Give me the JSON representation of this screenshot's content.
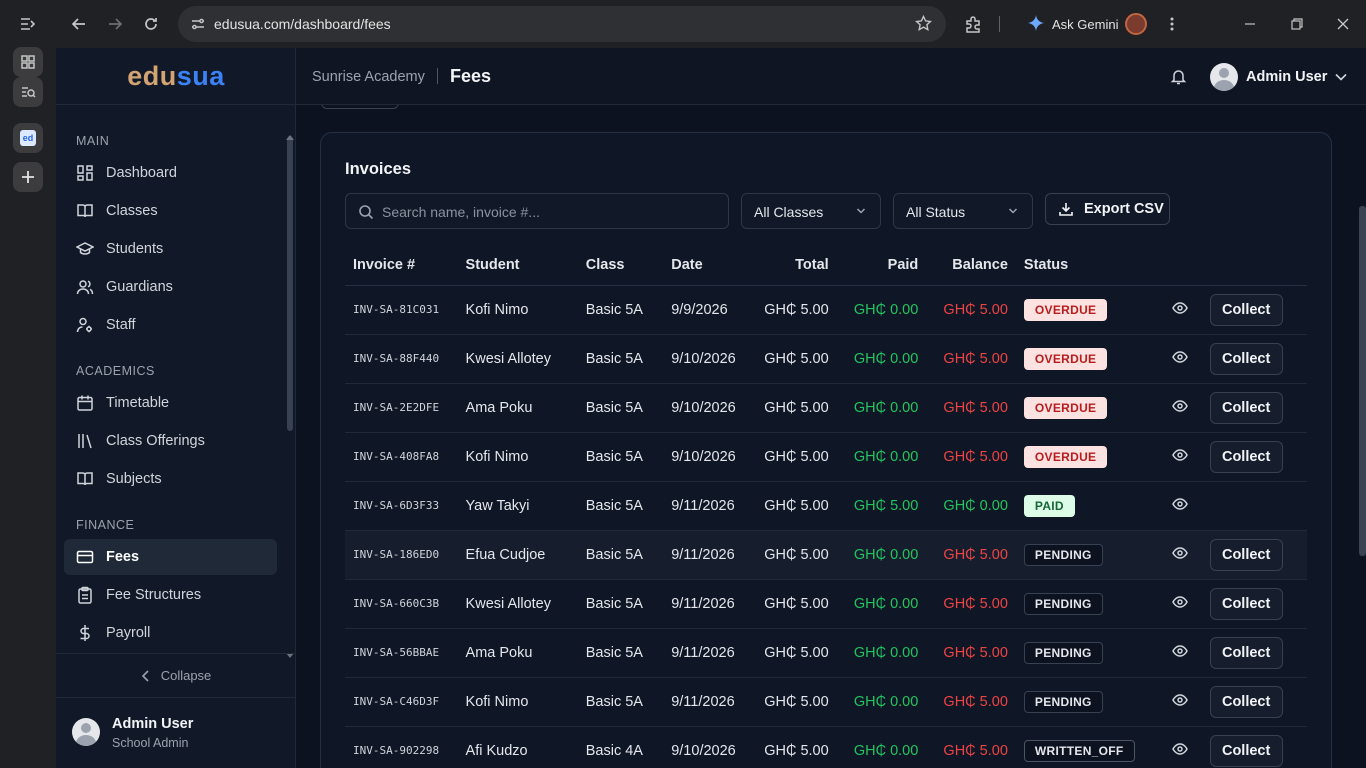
{
  "browser": {
    "url": "edusua.com/dashboard/fees",
    "gemini_label": "Ask Gemini"
  },
  "app": {
    "logo_part1": "edu",
    "logo_part2": "sua"
  },
  "sidebar": {
    "sections": [
      {
        "label": "MAIN",
        "items": [
          {
            "label": "Dashboard",
            "icon": "grid-icon"
          },
          {
            "label": "Classes",
            "icon": "book-open-icon"
          },
          {
            "label": "Students",
            "icon": "graduation-cap-icon"
          },
          {
            "label": "Guardians",
            "icon": "users-icon"
          },
          {
            "label": "Staff",
            "icon": "user-cog-icon"
          }
        ]
      },
      {
        "label": "ACADEMICS",
        "items": [
          {
            "label": "Timetable",
            "icon": "calendar-icon"
          },
          {
            "label": "Class Offerings",
            "icon": "library-icon"
          },
          {
            "label": "Subjects",
            "icon": "book-open-icon"
          }
        ]
      },
      {
        "label": "FINANCE",
        "items": [
          {
            "label": "Fees",
            "icon": "credit-card-icon",
            "active": true
          },
          {
            "label": "Fee Structures",
            "icon": "clipboard-icon"
          },
          {
            "label": "Payroll",
            "icon": "dollar-icon"
          }
        ]
      }
    ],
    "collapse_label": "Collapse",
    "user_name": "Admin User",
    "user_role": "School Admin"
  },
  "header": {
    "school": "Sunrise Academy",
    "page": "Fees",
    "user_name": "Admin User"
  },
  "invoices": {
    "title": "Invoices",
    "search_placeholder": "Search name, invoice #...",
    "class_filter": "All Classes",
    "status_filter": "All Status",
    "export_label": "Export CSV",
    "columns": [
      "Invoice #",
      "Student",
      "Class",
      "Date",
      "Total",
      "Paid",
      "Balance",
      "Status"
    ],
    "collect_label": "Collect",
    "rows": [
      {
        "invoice": "INV-SA-81C031",
        "student": "Kofi Nimo",
        "class": "Basic 5A",
        "date": "9/9/2026",
        "total": "GH₵ 5.00",
        "paid": "GH₵ 0.00",
        "balance": "GH₵ 5.00",
        "status": "OVERDUE"
      },
      {
        "invoice": "INV-SA-88F440",
        "student": "Kwesi Allotey",
        "class": "Basic 5A",
        "date": "9/10/2026",
        "total": "GH₵ 5.00",
        "paid": "GH₵ 0.00",
        "balance": "GH₵ 5.00",
        "status": "OVERDUE"
      },
      {
        "invoice": "INV-SA-2E2DFE",
        "student": "Ama Poku",
        "class": "Basic 5A",
        "date": "9/10/2026",
        "total": "GH₵ 5.00",
        "paid": "GH₵ 0.00",
        "balance": "GH₵ 5.00",
        "status": "OVERDUE"
      },
      {
        "invoice": "INV-SA-408FA8",
        "student": "Kofi Nimo",
        "class": "Basic 5A",
        "date": "9/10/2026",
        "total": "GH₵ 5.00",
        "paid": "GH₵ 0.00",
        "balance": "GH₵ 5.00",
        "status": "OVERDUE"
      },
      {
        "invoice": "INV-SA-6D3F33",
        "student": "Yaw Takyi",
        "class": "Basic 5A",
        "date": "9/11/2026",
        "total": "GH₵ 5.00",
        "paid": "GH₵ 5.00",
        "balance": "GH₵ 0.00",
        "status": "PAID"
      },
      {
        "invoice": "INV-SA-186ED0",
        "student": "Efua Cudjoe",
        "class": "Basic 5A",
        "date": "9/11/2026",
        "total": "GH₵ 5.00",
        "paid": "GH₵ 0.00",
        "balance": "GH₵ 5.00",
        "status": "PENDING"
      },
      {
        "invoice": "INV-SA-660C3B",
        "student": "Kwesi Allotey",
        "class": "Basic 5A",
        "date": "9/11/2026",
        "total": "GH₵ 5.00",
        "paid": "GH₵ 0.00",
        "balance": "GH₵ 5.00",
        "status": "PENDING"
      },
      {
        "invoice": "INV-SA-56BBAE",
        "student": "Ama Poku",
        "class": "Basic 5A",
        "date": "9/11/2026",
        "total": "GH₵ 5.00",
        "paid": "GH₵ 0.00",
        "balance": "GH₵ 5.00",
        "status": "PENDING"
      },
      {
        "invoice": "INV-SA-C46D3F",
        "student": "Kofi Nimo",
        "class": "Basic 5A",
        "date": "9/11/2026",
        "total": "GH₵ 5.00",
        "paid": "GH₵ 0.00",
        "balance": "GH₵ 5.00",
        "status": "PENDING"
      },
      {
        "invoice": "INV-SA-902298",
        "student": "Afi Kudzo",
        "class": "Basic 4A",
        "date": "9/10/2026",
        "total": "GH₵ 5.00",
        "paid": "GH₵ 0.00",
        "balance": "GH₵ 5.00",
        "status": "WRITTEN_OFF"
      }
    ]
  },
  "colors": {
    "brand_gold": "#d4a373",
    "brand_blue": "#3b82f6",
    "paid_green": "#22c55e",
    "balance_red": "#ef4444"
  }
}
